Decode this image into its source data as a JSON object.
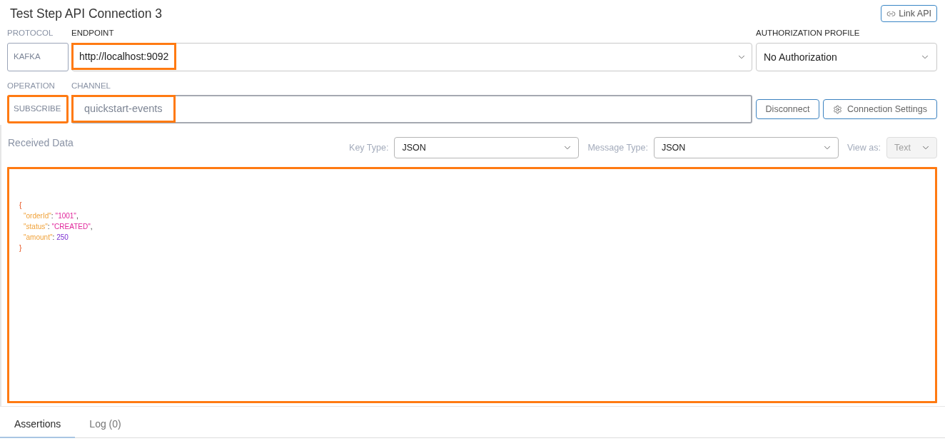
{
  "header": {
    "title": "Test Step API Connection 3",
    "link_button": "Link API"
  },
  "connection": {
    "protocol": {
      "label": "PROTOCOL",
      "value": "KAFKA",
      "disabled": true,
      "highlighted": false
    },
    "endpoint": {
      "label": "ENDPOINT",
      "value": "http://localhost:9092",
      "disabled": false,
      "highlighted": true
    },
    "authorization": {
      "label": "AUTHORIZATION PROFILE",
      "value": "No Authorization",
      "disabled": false
    },
    "operation": {
      "label": "OPERATION",
      "value": "SUBSCRIBE",
      "disabled": true,
      "highlighted": true
    },
    "channel": {
      "label": "CHANNEL",
      "value": "quickstart-events",
      "disabled": true,
      "highlighted": true
    },
    "buttons": [
      {
        "label": "Disconnect",
        "kind": "plain"
      },
      {
        "label": "Connection Settings",
        "kind": "settings"
      }
    ]
  },
  "received_data": {
    "title": "Received Data",
    "filters": [
      {
        "label": "Key Type:",
        "value": "JSON",
        "disabled": false
      },
      {
        "label": "Message Type:",
        "value": "JSON",
        "disabled": false
      },
      {
        "label": "View as:",
        "value": "Text",
        "disabled": true
      }
    ],
    "highlighted": true,
    "message": {
      "open": "{",
      "lines": [
        [
          {
            "kind": "key",
            "text": "\"orderId\""
          },
          {
            "kind": "punct",
            "text": ":"
          },
          {
            "kind": "string",
            "text": "\"1001\""
          },
          {
            "kind": "punct",
            "text": ","
          }
        ],
        [
          {
            "kind": "key",
            "text": "\"status\""
          },
          {
            "kind": "punct",
            "text": ":"
          },
          {
            "kind": "string",
            "text": "\"CREATED\""
          },
          {
            "kind": "punct",
            "text": ","
          }
        ],
        [
          {
            "kind": "key",
            "text": "\"amount\""
          },
          {
            "kind": "punct",
            "text": ":"
          },
          {
            "kind": "number",
            "text": "250"
          }
        ]
      ],
      "close": "}"
    }
  },
  "tabs": [
    {
      "label": "Assertions",
      "selected": true
    },
    {
      "label": "Log (0)",
      "selected": false
    }
  ]
}
